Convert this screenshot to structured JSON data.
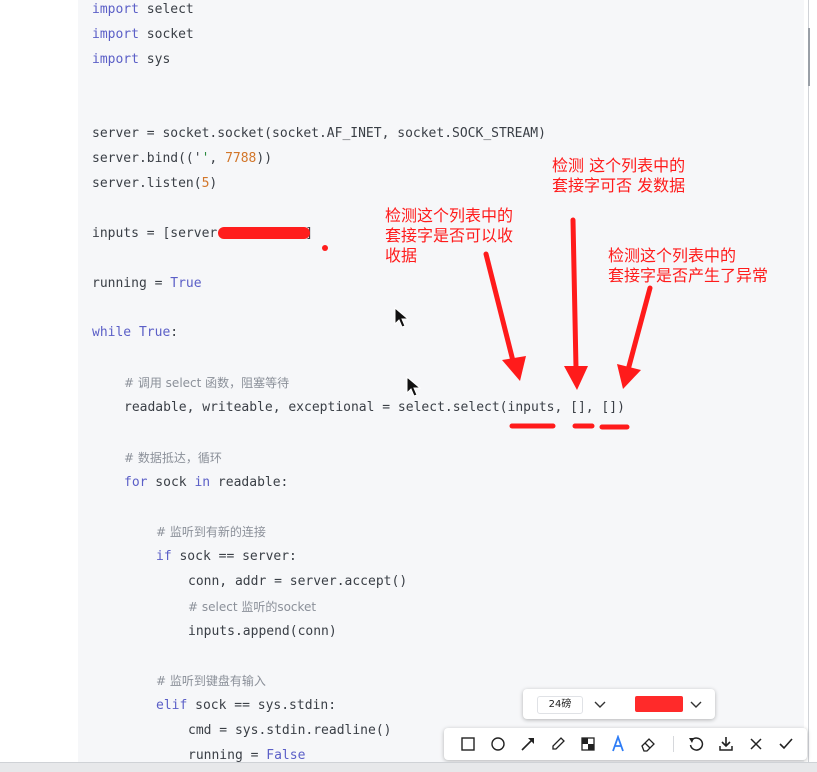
{
  "code": {
    "l1": {
      "kw": "import",
      "rest": " select"
    },
    "l2": {
      "kw": "import",
      "rest": " socket"
    },
    "l3": {
      "kw": "import",
      "rest": " sys"
    },
    "l4": {
      "pre": "server = socket.socket(socket.AF_INET, socket.SOCK_STREAM)"
    },
    "l5": {
      "pre": "server.bind(('",
      "str": "'",
      "mid": ", ",
      "num": "7788",
      "post": "))"
    },
    "l6": {
      "pre": "server.listen(",
      "num": "5",
      "post": ")"
    },
    "l7": {
      "pre": "inputs = [server",
      "post": "]"
    },
    "l8": {
      "pre": "running = ",
      "bool": "True"
    },
    "l9": {
      "kw": "while",
      "sp": " ",
      "bool": "True",
      "post": ":"
    },
    "l10": {
      "com": "# 调用 select 函数，阻塞等待"
    },
    "l11": {
      "pre": "readable, writeable, exceptional = select.select(inputs, [], [])"
    },
    "l12": {
      "com": "# 数据抵达，循环"
    },
    "l13": {
      "kw": "for",
      "mid": " sock ",
      "kw2": "in",
      "post": " readable:"
    },
    "l14": {
      "com": "# 监听到有新的连接"
    },
    "l15": {
      "kw": "if",
      "post": " sock == server:"
    },
    "l16": {
      "pre": "conn, addr = server.accept()"
    },
    "l17": {
      "com": "# select 监听的socket"
    },
    "l18": {
      "pre": "inputs.append(conn)"
    },
    "l19": {
      "com": "# 监听到键盘有输入"
    },
    "l20": {
      "kw": "elif",
      "post": " sock == sys.stdin:"
    },
    "l21": {
      "pre": "cmd = sys.stdin.readline()"
    },
    "l22": {
      "pre": "running = ",
      "bool": "False"
    }
  },
  "annotations": {
    "readable": "检测这个列表中的\n套接字是否可以收\n收据",
    "writeable": "检测 这个列表中的\n套接字可否 发数据",
    "exceptional": "检测这个列表中的\n套接字是否产生了异常"
  },
  "colors": {
    "annotation": "#ff1b1b",
    "keyword": "#5b5fc7",
    "number": "#d2762a",
    "comment": "#8b9099"
  },
  "fontbar": {
    "size_label": "24磅",
    "size_icon": "chevron-down-icon",
    "color_value": "#ff2a2a"
  },
  "toolbar": {
    "tools": [
      "rectangle-icon",
      "ellipse-icon",
      "arrow-icon",
      "pen-icon",
      "mosaic-icon",
      "text-icon",
      "eraser-icon",
      "undo-icon",
      "download-icon",
      "close-icon",
      "confirm-icon"
    ],
    "active_tool": "text-icon"
  }
}
